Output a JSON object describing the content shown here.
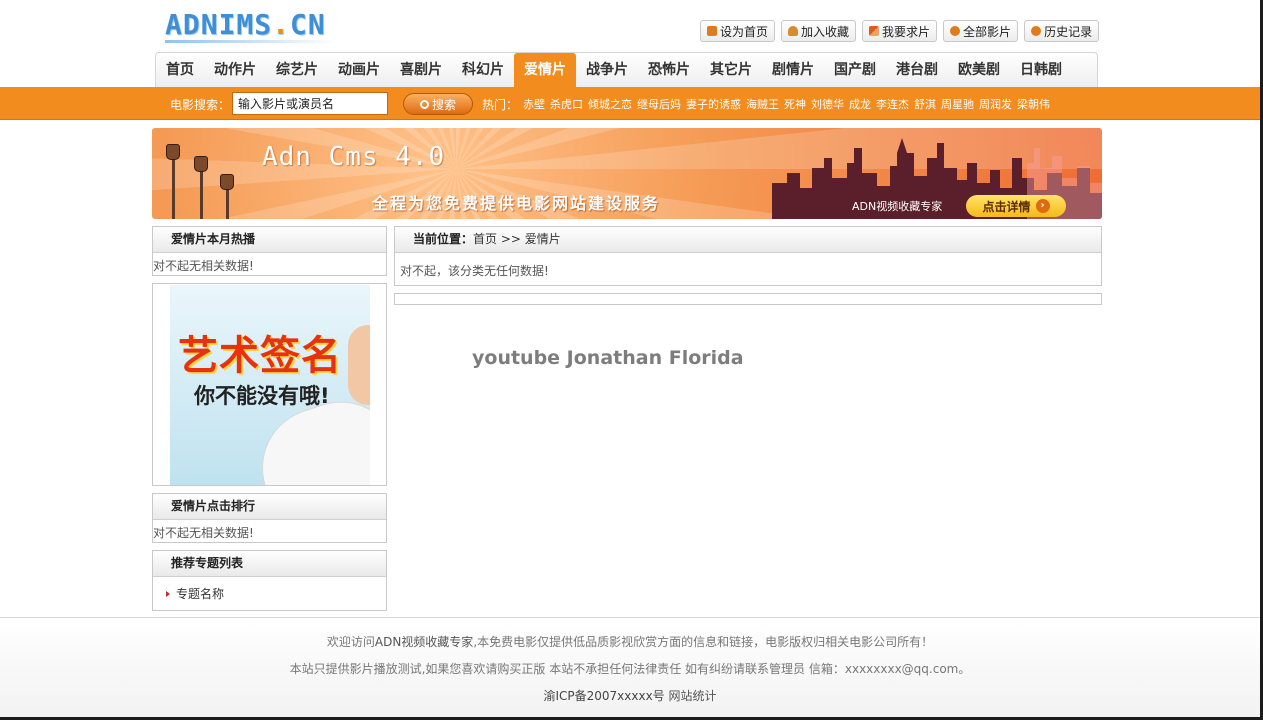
{
  "header": {
    "logo_main": "ADNIMS",
    "logo_dot": ".",
    "logo_tld": "CN",
    "toplinks": [
      {
        "label": "设为首页",
        "icon": "home-icon"
      },
      {
        "label": "加入收藏",
        "icon": "favorite-icon"
      },
      {
        "label": "我要求片",
        "icon": "request-icon"
      },
      {
        "label": "全部影片",
        "icon": "all-movies-icon"
      },
      {
        "label": "历史记录",
        "icon": "history-icon"
      }
    ]
  },
  "nav": {
    "items": [
      "首页",
      "动作片",
      "综艺片",
      "动画片",
      "喜剧片",
      "科幻片",
      "爱情片",
      "战争片",
      "恐怖片",
      "其它片",
      "剧情片",
      "国产剧",
      "港台剧",
      "欧美剧",
      "日韩剧"
    ],
    "active_index": 6
  },
  "search": {
    "label": "电影搜索：",
    "input_value": "输入影片或演员名",
    "button_label": "搜索",
    "hot_label": "热门：",
    "hot_items": [
      "赤壁",
      "杀虎口",
      "倾城之恋",
      "继母后妈",
      "妻子的诱惑",
      "海贼王",
      "死神",
      "刘德华",
      "成龙",
      "李连杰",
      "舒淇",
      "周星驰",
      "周润发",
      "梁朝伟"
    ]
  },
  "banner": {
    "title": "Adn Cms 4.0",
    "subtitle": "全程为您免费提供电影网站建设服务",
    "brand": "ADN视频收藏专家",
    "button_label": "点击详情"
  },
  "sidebar": {
    "hot_month_title": "爱情片本月热播",
    "hot_month_empty": "对不起无相关数据!",
    "ad_text_1": "艺术签名",
    "ad_text_2": "你不能没有哦!",
    "rank_title": "爱情片点击排行",
    "rank_empty": "对不起无相关数据!",
    "topics_title": "推荐专题列表",
    "topics": [
      "专题名称"
    ]
  },
  "main": {
    "location_label": "当前位置：",
    "crumb_home": "首页",
    "crumb_sep": " >> ",
    "crumb_current": "爱情片",
    "empty_message": "对不起，该分类无任何数据!",
    "watermark": "youtube Jonathan Florida"
  },
  "footer": {
    "line1_prefix": "欢迎访问",
    "line1_link": "ADN视频收藏专家",
    "line1_suffix": ",本免费电影仅提供低品质影视欣赏方面的信息和链接，电影版权归相关电影公司所有！",
    "line2": "本站只提供影片播放测试,如果您喜欢请购买正版 本站不承担任何法律责任 如有纠纷请联系管理员 信箱：xxxxxxxx@qq.com。",
    "icp": "渝ICP备2007xxxxx号",
    "stats": "网站统计"
  },
  "colors": {
    "accent": "#f28c1e",
    "logo_blue": "#3f8fd6",
    "banner_dark": "#5a1f2a"
  }
}
